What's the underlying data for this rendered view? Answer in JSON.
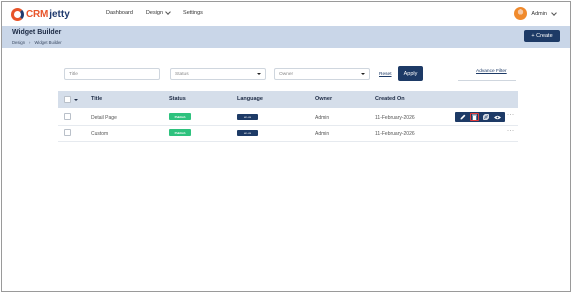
{
  "brand": {
    "name_a": "CRM",
    "name_b": "jetty"
  },
  "nav": {
    "items": [
      {
        "label": "Dashboard",
        "dropdown": false
      },
      {
        "label": "Design",
        "dropdown": true
      },
      {
        "label": "Settings",
        "dropdown": false
      }
    ]
  },
  "user": {
    "name": "Admin"
  },
  "header": {
    "title": "Widget Builder",
    "breadcrumb": [
      "Design",
      "›",
      "Widget Builder"
    ],
    "create_label": "+ Create"
  },
  "filters": {
    "title_placeholder": "Title",
    "status_placeholder": "Status",
    "owner_placeholder": "Owner",
    "reset_label": "Reset",
    "apply_label": "Apply",
    "advanced_label": "Advance Filter"
  },
  "table": {
    "headers": [
      "Title",
      "Status",
      "Language",
      "Owner",
      "Created On"
    ],
    "rows": [
      {
        "title": "Detail Page",
        "status": "Publish",
        "language": "en-us",
        "owner": "Admin",
        "created_on": "11-February-2026"
      },
      {
        "title": "Custom",
        "status": "Publish",
        "language": "en-us",
        "owner": "Admin",
        "created_on": "11-February-2026"
      }
    ],
    "more_label": "···"
  },
  "colors": {
    "brand_dark": "#1d3a66",
    "brand_orange": "#e8542a",
    "publish_green": "#2ec27e",
    "header_band": "#c9d6e8"
  },
  "icons": [
    "edit-icon",
    "delete-icon",
    "copy-icon",
    "view-icon",
    "kebab-icon",
    "chevron-down-icon",
    "avatar"
  ]
}
